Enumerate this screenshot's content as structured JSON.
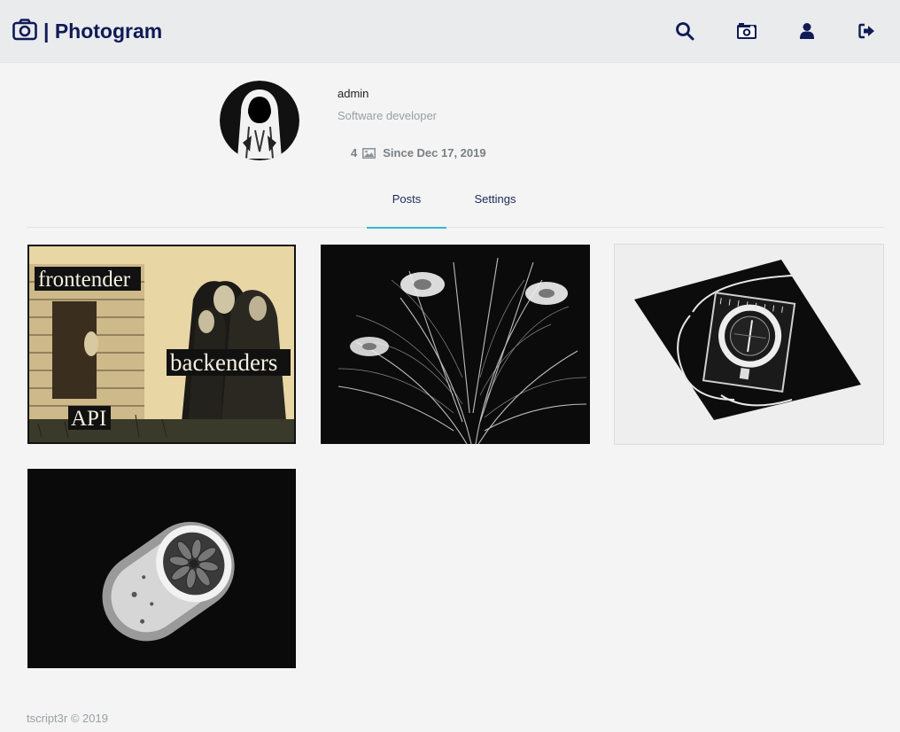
{
  "app": {
    "title": "| Photogram",
    "logo_icon": "camera-icon"
  },
  "nav": {
    "icons": [
      "search-icon",
      "photo-camera-icon",
      "user-icon",
      "logout-icon"
    ]
  },
  "profile": {
    "username": "admin",
    "bio": "Software developer",
    "post_count": "4",
    "since": "Since Dec 17, 2019"
  },
  "tabs": [
    {
      "label": "Posts",
      "active": true
    },
    {
      "label": "Settings",
      "active": false
    }
  ],
  "posts": {
    "meme": {
      "label_frontender": "frontender",
      "label_backenders": "backenders",
      "label_api": "API"
    }
  },
  "footer": {
    "text": "tscript3r © 2019"
  },
  "colors": {
    "brand": "#101a55",
    "active_tab_underline": "#36b5d8",
    "topbar": "#e9ebed",
    "background": "#f3f4f3"
  }
}
